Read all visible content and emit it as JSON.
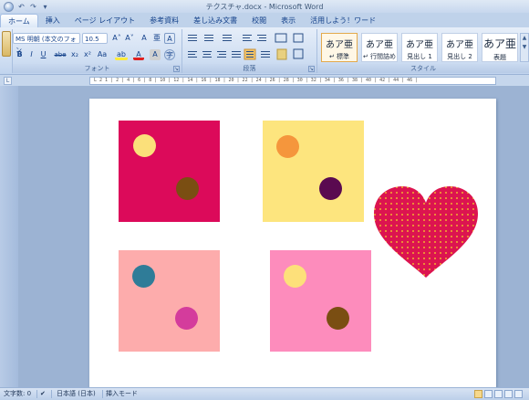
{
  "window": {
    "title": "テクスチャ.docx - Microsoft Word"
  },
  "qat": {
    "undo": "↶",
    "redo": "↷",
    "more": "▾"
  },
  "tabs": [
    "ホーム",
    "挿入",
    "ページ レイアウト",
    "参考資料",
    "差し込み文書",
    "校閲",
    "表示",
    "活用しよう！ワード"
  ],
  "ribbon": {
    "font": {
      "label": "フォント",
      "font_name": "MS 明朝 (本文のフォン",
      "font_size": "10.5",
      "grow": "A˄",
      "shrink": "A˅",
      "clear": "A",
      "phonetic": "亜",
      "border": "A",
      "bold": "B",
      "italic": "I",
      "underline": "U",
      "strike": "abe",
      "sub": "x₂",
      "sup": "x²",
      "case": "Aa",
      "highlight": "ab",
      "color": "A",
      "shade": "A",
      "enclose": "字"
    },
    "paragraph": {
      "label": "段落"
    },
    "styles": {
      "label": "スタイル",
      "items": [
        {
          "sample": "あア亜",
          "name": "↵ 標準"
        },
        {
          "sample": "あア亜",
          "name": "↵ 行間詰め"
        },
        {
          "sample": "あア亜",
          "name": "見出し 1"
        },
        {
          "sample": "あア亜",
          "name": "見出し 2"
        },
        {
          "sample": "あア亜",
          "name": "表題"
        }
      ]
    }
  },
  "ruler": {
    "numbers": "L  2 1 | 2 | 4 | 6 | 8 | 10 | 12 | 14 | 16 | 18 | 20 | 22 | 24 | 26 | 28 | 30 | 32 | 34 | 36 | 38 | 40 | 42 | 44 | 46 |"
  },
  "document": {
    "squares": [
      {
        "color": "#dc0a5a",
        "dot1": "#fbe07a",
        "dot2": "#7a4e12"
      },
      {
        "color": "#fde57e",
        "dot1": "#f5963c",
        "dot2": "#5a0a50"
      },
      {
        "color": "#fdacac",
        "dot1": "#2f7c98",
        "dot2": "#d43c9c"
      },
      {
        "color": "#fd8cbc",
        "dot1": "#fde07a",
        "dot2": "#7a4e12"
      }
    ],
    "heart": {
      "fill": "#dc1450",
      "dots": "#f0b030"
    }
  },
  "status": {
    "word_count": "文字数: 0",
    "language": "日本語 (日本)",
    "mode": "挿入モード"
  }
}
